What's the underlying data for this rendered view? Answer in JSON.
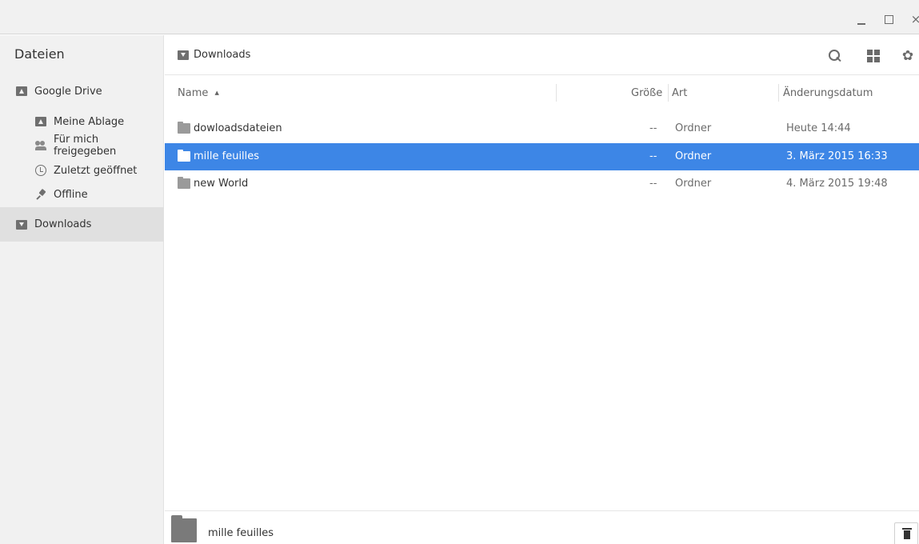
{
  "window": {
    "minimize": "_",
    "maximize": "",
    "close": "×"
  },
  "sidebar": {
    "title": "Dateien",
    "items": [
      {
        "label": "Google Drive",
        "icon": "google-drive-icon"
      },
      {
        "label": "Meine Ablage",
        "icon": "drive-folder-icon"
      },
      {
        "label": "Für mich freigegeben",
        "icon": "people-icon"
      },
      {
        "label": "Zuletzt geöffnet",
        "icon": "clock-icon"
      },
      {
        "label": "Offline",
        "icon": "pin-icon"
      },
      {
        "label": "Downloads",
        "icon": "downloads-icon",
        "active": true
      }
    ]
  },
  "header": {
    "breadcrumb": "Downloads",
    "gear_glyph": "✿"
  },
  "columns": {
    "name": "Name",
    "sort_indicator": "▲",
    "size": "Größe",
    "type": "Art",
    "date": "Änderungsdatum"
  },
  "files": [
    {
      "name": "dowloadsdateien",
      "size": "--",
      "type": "Ordner",
      "date": "Heute 14:44",
      "selected": false
    },
    {
      "name": "mille feuilles",
      "size": "--",
      "type": "Ordner",
      "date": "3. März 2015 16:33",
      "selected": true
    },
    {
      "name": "new World",
      "size": "--",
      "type": "Ordner",
      "date": "4. März 2015 19:48",
      "selected": false
    }
  ],
  "preview": {
    "name": "mille feuilles"
  },
  "colors": {
    "selection": "#3d86e6",
    "sidebar_bg": "#f1f1f1",
    "active_item_bg": "#e0e0e0"
  }
}
